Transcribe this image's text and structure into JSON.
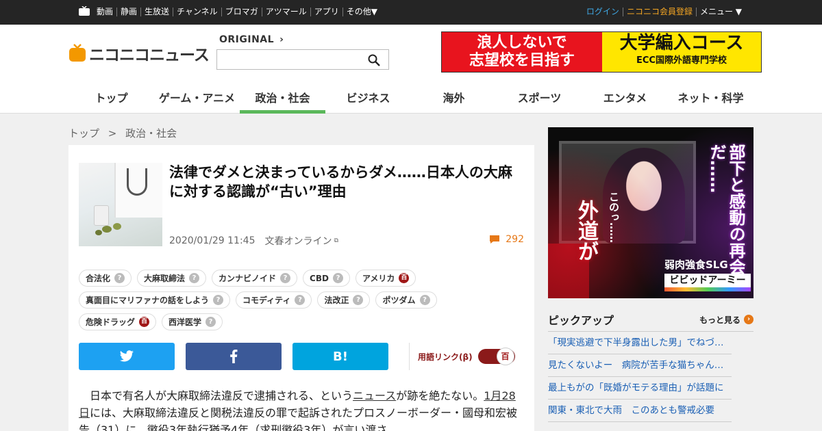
{
  "topbar": {
    "nav": [
      "動画",
      "静画",
      "生放送",
      "チャンネル",
      "ブロマガ",
      "アツマール",
      "アプリ",
      "その他▼"
    ],
    "login": "ログイン",
    "register": "ニコニコ会員登録",
    "menu": "メニュー ▼"
  },
  "header": {
    "logo_text": "ニコニコニュース",
    "original_label": "ORIGINAL",
    "search_placeholder": "",
    "banner": {
      "left_line1": "浪人しないで",
      "left_line2": "志望校を目指す",
      "right_line1": "大学編入コース",
      "right_line2": "ECC国際外語専門学校"
    },
    "categories": [
      "トップ",
      "ゲーム・アニメ",
      "政治・社会",
      "ビジネス",
      "海外",
      "スポーツ",
      "エンタメ",
      "ネット・科学"
    ],
    "active_category": "政治・社会"
  },
  "breadcrumb": {
    "home": "トップ",
    "sep": ">",
    "current": "政治・社会"
  },
  "article": {
    "title": "法律でダメと決まっているからダメ……日本人の大麻に対する認識が“古い”理由",
    "datetime": "2020/01/29 11:45",
    "source": "文春オンライン",
    "comment_count": "292",
    "tags_row1": [
      {
        "label": "合法化",
        "mark": "?"
      },
      {
        "label": "大麻取締法",
        "mark": "?"
      },
      {
        "label": "カンナビノイド",
        "mark": "?"
      },
      {
        "label": "CBD",
        "mark": "?"
      },
      {
        "label": "アメリカ",
        "mark": "百"
      }
    ],
    "tags_row2": [
      {
        "label": "真面目にマリファナの話をしよう",
        "mark": "?"
      },
      {
        "label": "コモディティ",
        "mark": "?"
      },
      {
        "label": "法改正",
        "mark": "?"
      },
      {
        "label": "ポツダム",
        "mark": "?"
      }
    ],
    "tags_row3": [
      {
        "label": "危険ドラッグ",
        "mark": "百"
      },
      {
        "label": "西洋医学",
        "mark": "?"
      }
    ],
    "share": {
      "hatena_label": "B!",
      "yogo_label": "用語リンク(β)",
      "toggle_mark": "百"
    },
    "body_p1_pre": "　日本で有名人が大麻取締法違反で逮捕される、という",
    "body_p1_link": "ニュース",
    "body_p1_post": "が跡を絶たない。",
    "body_p2_link": "1月28日",
    "body_p2_post": "には、大麻取締法違反と関税法違反の罪で起訴されたプロスノーボーダー・國母和宏被告（31）に、懲役3年執行猶予4年（求刑懲役3年）が言い渡さ"
  },
  "sidebar": {
    "ad": {
      "vtext_right": "部下と感動の再会だ……",
      "vtext_left": "外道が",
      "conono": "このっ……",
      "slg": "弱肉強食SLG",
      "brand": "ビビッドアーミー"
    },
    "pickup_title": "ピックアップ",
    "pickup_more": "もっと見る",
    "pickup_items": [
      "「現実逃避で下半身露出した男」でねづ…",
      "見たくないよー　病院が苦手な猫ちゃん…",
      "最上もがの「既婚がモテる理由」が話題に",
      "関東・東北で大雨　このあとも警戒必要"
    ]
  },
  "colors": {
    "accent_green": "#5bb85b",
    "comment_orange": "#e67817",
    "link_blue": "#1a5fb4",
    "twitter": "#1da1f2",
    "facebook": "#3b5998",
    "hatena": "#00a4de"
  }
}
